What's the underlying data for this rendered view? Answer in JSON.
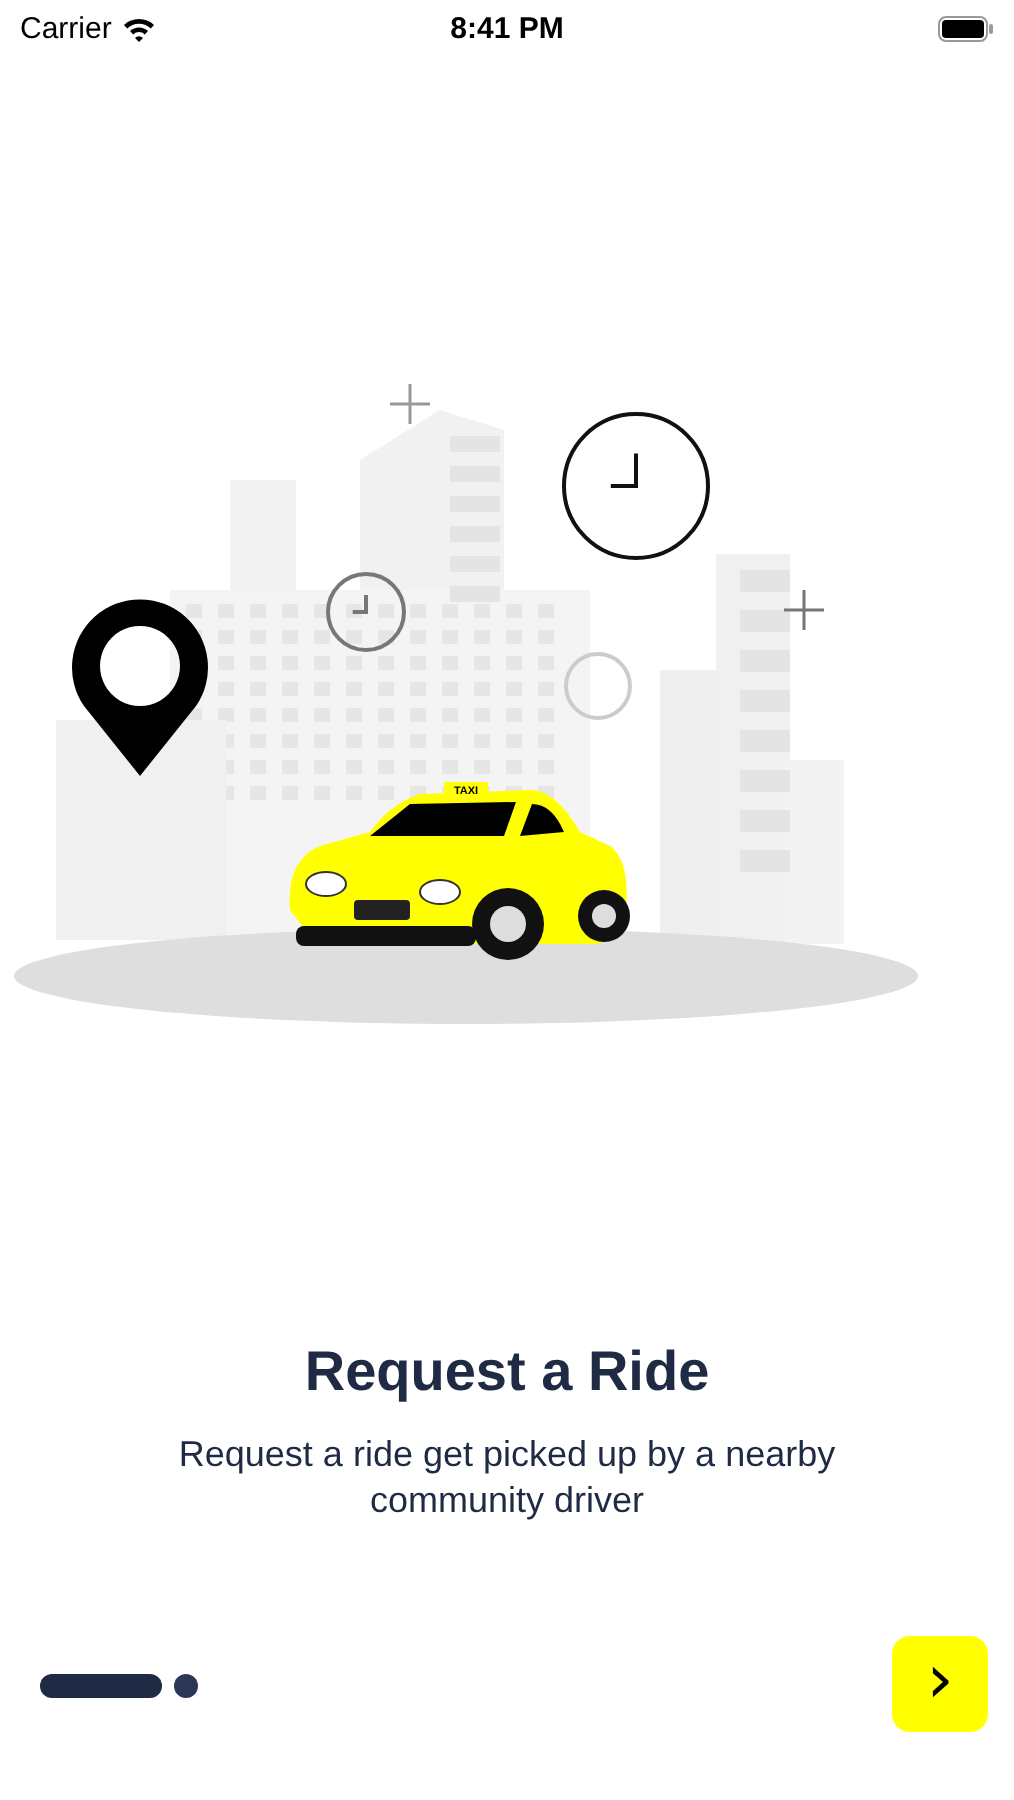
{
  "status_bar": {
    "carrier": "Carrier",
    "time": "8:41 PM"
  },
  "illustration": {
    "taxi_sign": "TAXI"
  },
  "title": "Request a Ride",
  "description": "Request a ride get picked up by a nearby community driver",
  "pages": [
    {
      "selected": true
    },
    {
      "selected": false
    }
  ],
  "next_button": {
    "label": "›"
  }
}
